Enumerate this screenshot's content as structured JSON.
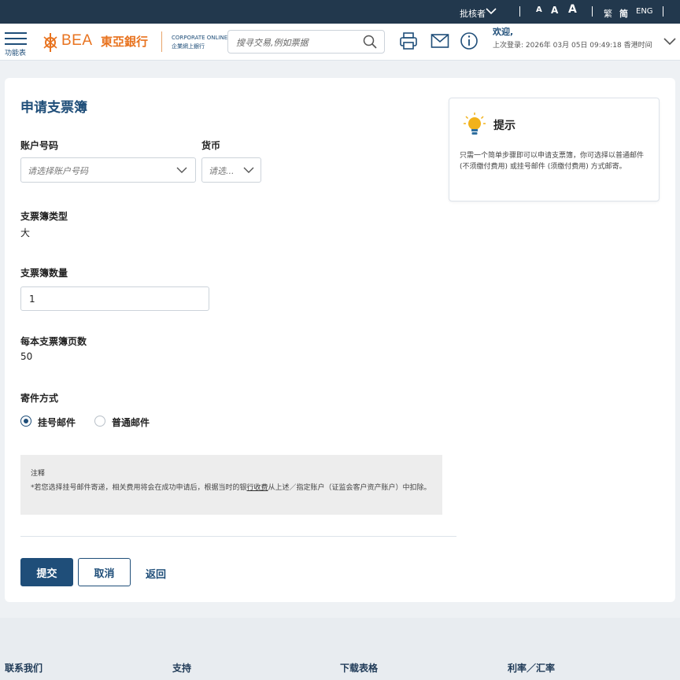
{
  "topbar": {
    "role": "批核者",
    "font_sizes": [
      "A",
      "A",
      "A"
    ],
    "lang_trad": "繁",
    "lang_simp": "简",
    "lang_eng": "ENG"
  },
  "header": {
    "menu_label": "功能表",
    "logo_en": "BEA",
    "logo_zh": "東亞銀行",
    "corp_en": "CORPORATE ONLINE",
    "corp_zh": "企業網上銀行",
    "search_placeholder": "搜寻交易,例如票据",
    "welcome": "欢迎,",
    "last_login": "上次登录: 2026年 03月 05日 09:49:18 香港时间"
  },
  "form": {
    "title": "申请支票簿",
    "account_label": "账户号码",
    "account_placeholder": "请选择账户号码",
    "currency_label": "货币",
    "currency_placeholder": "请选...",
    "book_type_label": "支票簿类型",
    "book_type_value": "大",
    "quantity_label": "支票簿数量",
    "quantity_value": "1",
    "pages_label": "每本支票簿页数",
    "pages_value": "50",
    "delivery_label": "寄件方式",
    "delivery_options": [
      {
        "label": "挂号邮件",
        "selected": true
      },
      {
        "label": "普通邮件",
        "selected": false
      }
    ]
  },
  "note": {
    "title": "注释",
    "body_before": "*若您选择挂号邮件寄递，相关费用将会在成功申请后，根据当时的银",
    "body_link": "行收费",
    "body_after": "从上述／指定账户（证监会客户资产账户）中扣除。"
  },
  "actions": {
    "submit": "提交",
    "cancel": "取消",
    "back": "返回"
  },
  "tip": {
    "title": "提示",
    "body": "只需一个简单步骤即可以申请支票簿，你可选择以普通邮件 (不须缴付费用) 或挂号邮件 (须缴付费用) 方式邮寄。"
  },
  "footer": {
    "links": [
      "联系我们",
      "支持",
      "下载表格",
      "利率／汇率"
    ]
  },
  "colors": {
    "topbar": "#22384d",
    "primary": "#1f4e79",
    "brand_orange": "#e8731f"
  }
}
